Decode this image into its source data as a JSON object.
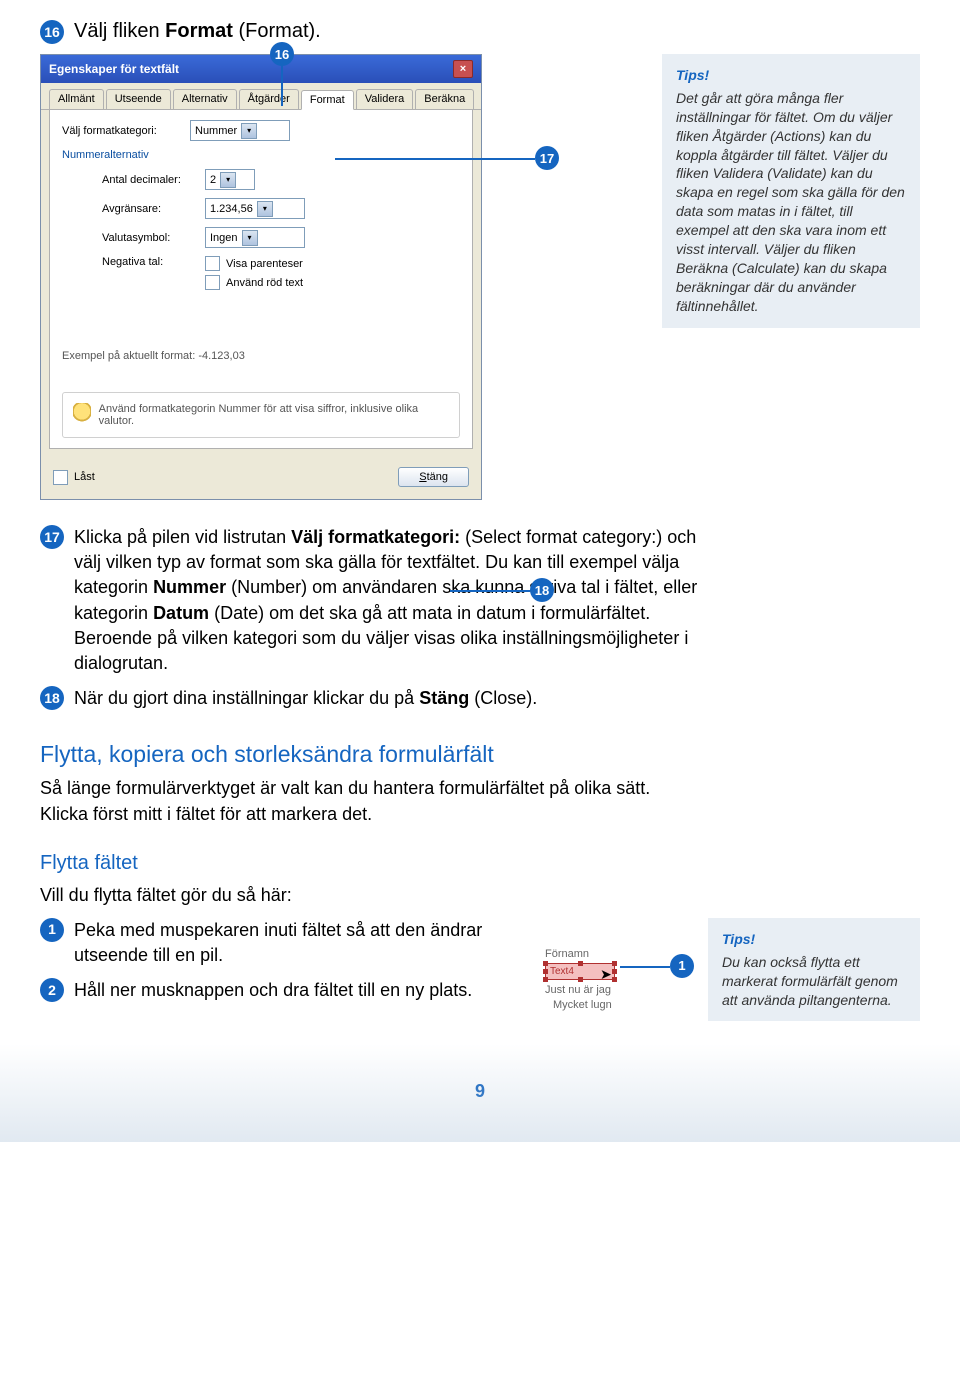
{
  "step16": {
    "num": "16",
    "prefix": "Välj fliken ",
    "bold": "Format",
    "suffix": " (Format)."
  },
  "callouts": {
    "c16": "16",
    "c17": "17",
    "c18": "18"
  },
  "dialog": {
    "title": "Egenskaper för textfält",
    "close": "×",
    "tabs": [
      "Allmänt",
      "Utseende",
      "Alternativ",
      "Åtgärder",
      "Format",
      "Validera",
      "Beräkna"
    ],
    "active_tab_index": 4,
    "selcat_label": "Välj formatkategori:",
    "selcat_value": "Nummer",
    "subheader": "Nummeralternativ",
    "dec_label": "Antal decimaler:",
    "dec_value": "2",
    "sep_label": "Avgränsare:",
    "sep_value": "1.234,56",
    "cur_label": "Valutasymbol:",
    "cur_value": "Ingen",
    "neg_label": "Negativa tal:",
    "neg_chk1": "Visa parenteser",
    "neg_chk2": "Använd röd text",
    "example_label": "Exempel på aktuellt format:  -4.123,03",
    "hint": "Använd formatkategorin Nummer för att visa siffror, inklusive olika valutor.",
    "locked": "Låst",
    "close_btn": "Stäng"
  },
  "tips1": {
    "title": "Tips!",
    "body": "Det går att göra många fler inställningar för fältet. Om du väljer fliken Åtgärder (Actions) kan du koppla åtgärder till fältet. Väljer du fliken Validera (Validate) kan du skapa en regel som ska gälla för den data som matas in i fältet, till exempel att den ska vara inom ett visst intervall. Väljer du fliken Beräkna (Calculate) kan du skapa beräkningar där du använder fältinnehållet."
  },
  "step17": {
    "num": "17",
    "text_a": "Klicka på pilen vid listrutan ",
    "bold_a": "Välj formatkategori:",
    "text_b": " (Select format category:) och välj vilken typ av format som ska gälla för textfältet. Du kan till exempel välja kategorin ",
    "bold_b": "Nummer",
    "text_c": " (Number) om användaren ska kunna skriva tal i fältet, eller kategorin ",
    "bold_c": "Datum",
    "text_d": " (Date) om det ska gå att mata in datum i formulärfältet. Beroende på vilken kategori som du väljer visas olika inställningsmöjligheter i dialogrutan."
  },
  "step18": {
    "num": "18",
    "text_a": "När du gjort dina inställningar klickar du på ",
    "bold_a": "Stäng",
    "text_b": " (Close)."
  },
  "h2": "Flytta, kopiera och storleksändra formulärfält",
  "h2_body": "Så länge formulärverktyget är valt kan du hantera formulärfältet på olika sätt. Klicka först mitt i fältet för att markera det.",
  "h3": "Flytta fältet",
  "h3_intro": "Vill du flytta fältet gör du så här:",
  "step1": {
    "num": "1",
    "text": "Peka med muspekaren inuti fältet så att den ändrar utseende till en pil."
  },
  "step2": {
    "num": "2",
    "text": "Håll ner musknappen och dra fältet till en ny plats."
  },
  "field_mock": {
    "lbl1": "Förnamn",
    "val": "Text4",
    "lbl2": "Just nu är jag",
    "lbl3": "Mycket lugn",
    "callout": "1"
  },
  "tips2": {
    "title": "Tips!",
    "body": "Du kan också flytta ett markerat formulärfält genom att använda piltangenterna."
  },
  "pagenum": "9"
}
